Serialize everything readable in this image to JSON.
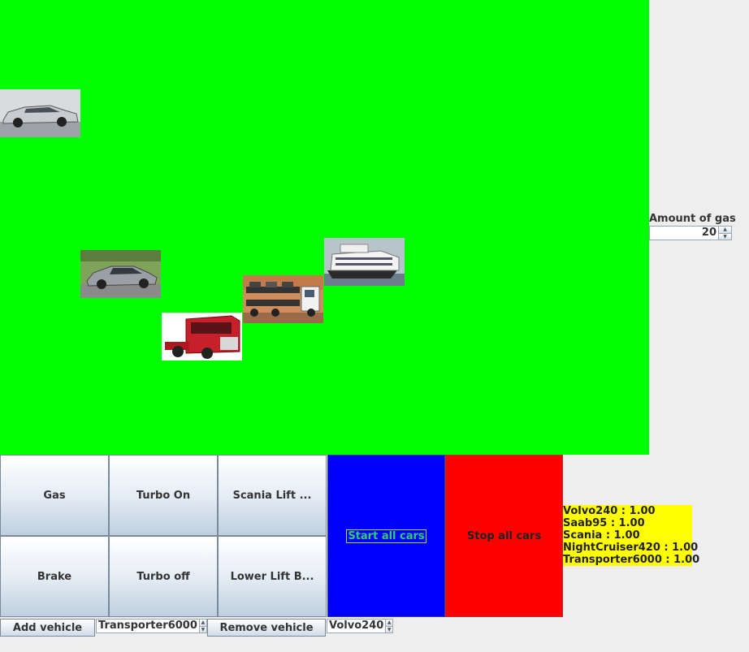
{
  "app": {
    "canvas_color": "#00ff00"
  },
  "vehicles": [
    {
      "name": "Volvo240",
      "icon": "volvo-car-image"
    },
    {
      "name": "Saab95",
      "icon": "saab-car-image"
    },
    {
      "name": "Scania",
      "icon": "scania-truck-image"
    },
    {
      "name": "Transporter6000",
      "icon": "car-transporter-image"
    },
    {
      "name": "NightCruiser420",
      "icon": "ferry-ship-image"
    }
  ],
  "gas": {
    "label": "Amount of gas",
    "value": "20"
  },
  "controls": {
    "gas": "Gas",
    "turbo_on": "Turbo On",
    "scania_lift": "Scania Lift ...",
    "brake": "Brake",
    "turbo_off": "Turbo off",
    "lower_lift": "Lower Lift B...",
    "start_all": "Start all cars",
    "stop_all": "Stop all cars"
  },
  "colors": {
    "start_bg": "#0000ff",
    "stop_bg": "#ff0000",
    "speed_bg": "#ffff00"
  },
  "speeds": [
    "Volvo240 : 1.00",
    "Saab95 : 1.00",
    "Scania : 1.00",
    "NightCruiser420 : 1.00",
    "Transporter6000 : 1.00"
  ],
  "bottom": {
    "add_label": "Add vehicle",
    "add_select": "Transporter6000",
    "remove_label": "Remove vehicle",
    "remove_select": "Volvo240"
  }
}
